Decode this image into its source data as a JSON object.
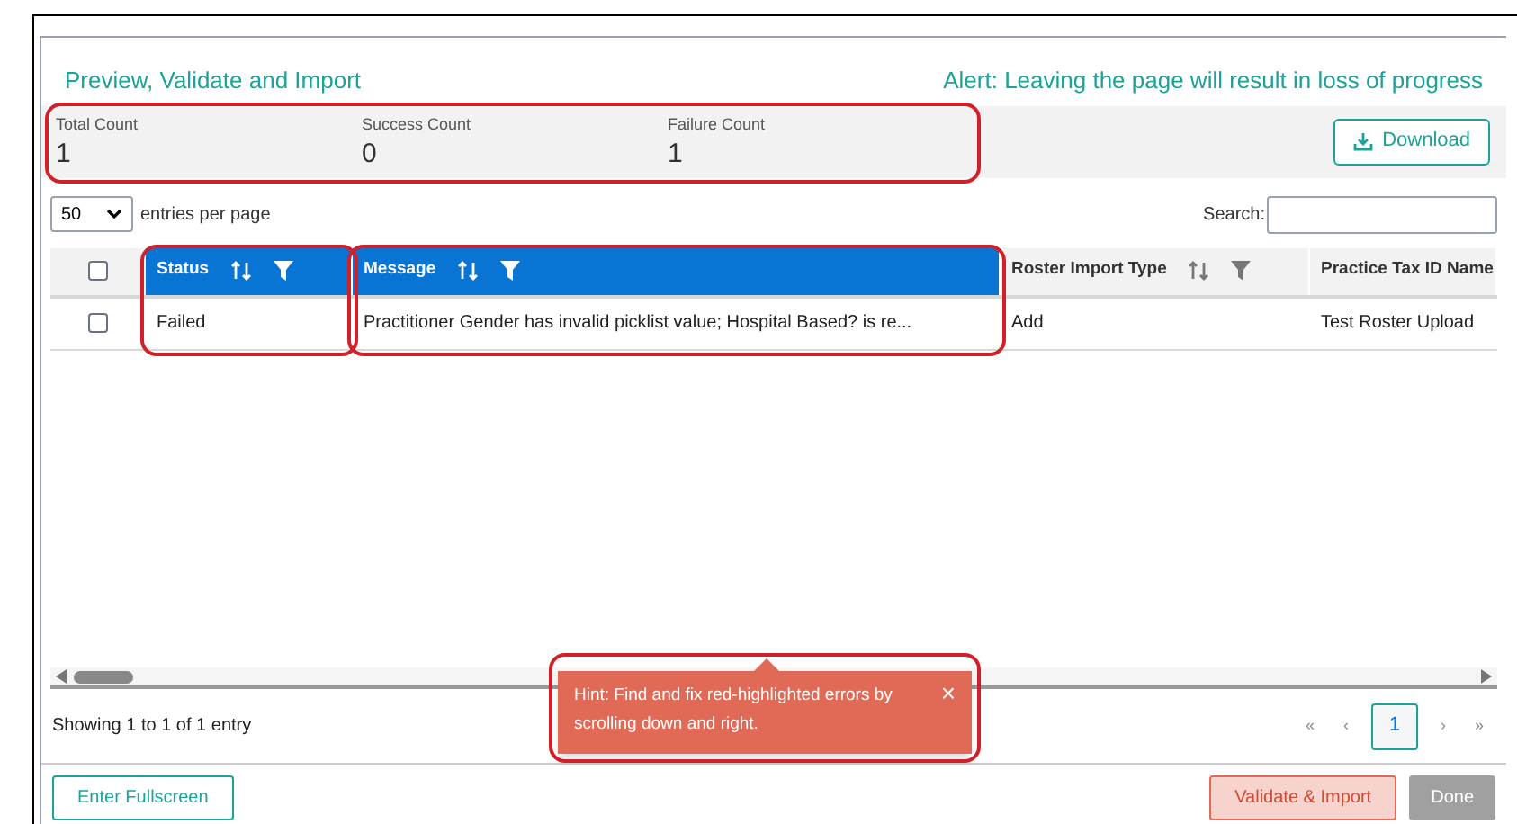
{
  "header": {
    "title": "Preview, Validate and Import",
    "alert": "Alert: Leaving the page will result in loss of progress"
  },
  "stats": {
    "highlighted": true,
    "items": [
      {
        "label": "Total Count",
        "value": "1"
      },
      {
        "label": "Success Count",
        "value": "0"
      },
      {
        "label": "Failure Count",
        "value": "1"
      }
    ]
  },
  "download_button": "Download",
  "page_size": {
    "value": "50",
    "label": "entries per page"
  },
  "search": {
    "label": "Search:"
  },
  "table": {
    "header_checked": false,
    "columns": [
      {
        "label": "Status",
        "sortable": true,
        "filterable": true,
        "selected": true,
        "highlighted": true
      },
      {
        "label": "Message",
        "sortable": true,
        "filterable": true,
        "selected": true,
        "highlighted": true
      },
      {
        "label": "Roster Import Type",
        "sortable": true,
        "filterable": true,
        "selected": false,
        "highlighted": false
      },
      {
        "label": "Practice Tax ID Name",
        "selected": false
      }
    ],
    "rows": [
      {
        "checked": false,
        "cells": [
          "Failed",
          "Practitioner Gender has invalid picklist value; Hospital Based? is re...",
          "Add",
          "Test Roster Upload"
        ]
      }
    ]
  },
  "footer": {
    "info": "Showing 1 to 1 of 1 entry",
    "pages": [
      {
        "label": "«",
        "kind": "nav"
      },
      {
        "label": "‹",
        "kind": "nav"
      },
      {
        "label": "1",
        "kind": "page",
        "selected": true
      },
      {
        "label": "›",
        "kind": "nav"
      },
      {
        "label": "»",
        "kind": "nav"
      }
    ]
  },
  "toast": {
    "text": "Hint: Find and fix red-highlighted errors by scrolling down and right.",
    "close": "×",
    "highlighted": true
  },
  "actions": [
    {
      "label": "Enter Fullscreen",
      "kind": "outline",
      "disabled": false
    },
    {
      "label": "Validate & Import",
      "kind": "danger",
      "disabled": true
    },
    {
      "label": "Done",
      "kind": "primary",
      "disabled": true
    }
  ]
}
